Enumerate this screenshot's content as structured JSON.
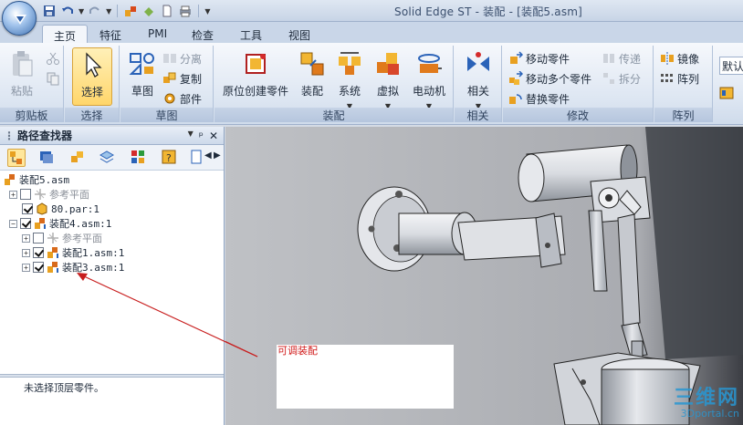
{
  "window": {
    "title": "Solid Edge ST - 装配 - [装配5.asm]"
  },
  "tabs": [
    "主页",
    "特征",
    "PMI",
    "检查",
    "工具",
    "视图"
  ],
  "active_tab": "主页",
  "ribbon": {
    "clipboard": {
      "label": "剪贴板",
      "paste": "粘贴"
    },
    "select": {
      "label": "选择",
      "select": "选择"
    },
    "sketch": {
      "label": "草图",
      "sketch": "草图",
      "separate": "分离",
      "copy": "复制",
      "part": "部件"
    },
    "assembly": {
      "label": "装配",
      "insitu": "原位创建零件",
      "assemble": "装配",
      "system": "系统",
      "virtual": "虚拟",
      "motor": "电动机"
    },
    "relations": {
      "label": "相关",
      "relate": "相关"
    },
    "modify": {
      "label": "修改",
      "move_part": "移动零件",
      "move_parts": "移动多个零件",
      "replace_part": "替换零件",
      "transfer": "传递",
      "disperse": "拆分"
    },
    "pattern": {
      "label": "阵列",
      "mirror": "镜像",
      "pattern": "阵列"
    },
    "overflow": {
      "default_label": "默认"
    }
  },
  "pathfinder": {
    "title": "路径查找器",
    "tree": [
      {
        "label": "装配5.asm",
        "level": 0
      },
      {
        "label": "参考平面",
        "level": 1,
        "expand": "+",
        "checked": false,
        "dim": true
      },
      {
        "label": "80.par:1",
        "level": 1,
        "checked": true
      },
      {
        "label": "装配4.asm:1",
        "level": 1,
        "expand": "-",
        "checked": true
      },
      {
        "label": "参考平面",
        "level": 2,
        "expand": "+",
        "checked": false,
        "dim": true
      },
      {
        "label": "装配1.asm:1",
        "level": 2,
        "expand": "+",
        "checked": true
      },
      {
        "label": "装配3.asm:1",
        "level": 2,
        "expand": "+",
        "checked": true
      }
    ],
    "status": "未选择顶层零件。"
  },
  "annotation": {
    "text": "可调装配",
    "color": "#d11a1a"
  },
  "watermark": {
    "line1": "三维网",
    "line2": "3Dportal.cn"
  },
  "colors": {
    "accent_active": "#ffd66b",
    "ribbon_bg": "#dde6f2",
    "viewport_bg": "#bdbfc3"
  }
}
